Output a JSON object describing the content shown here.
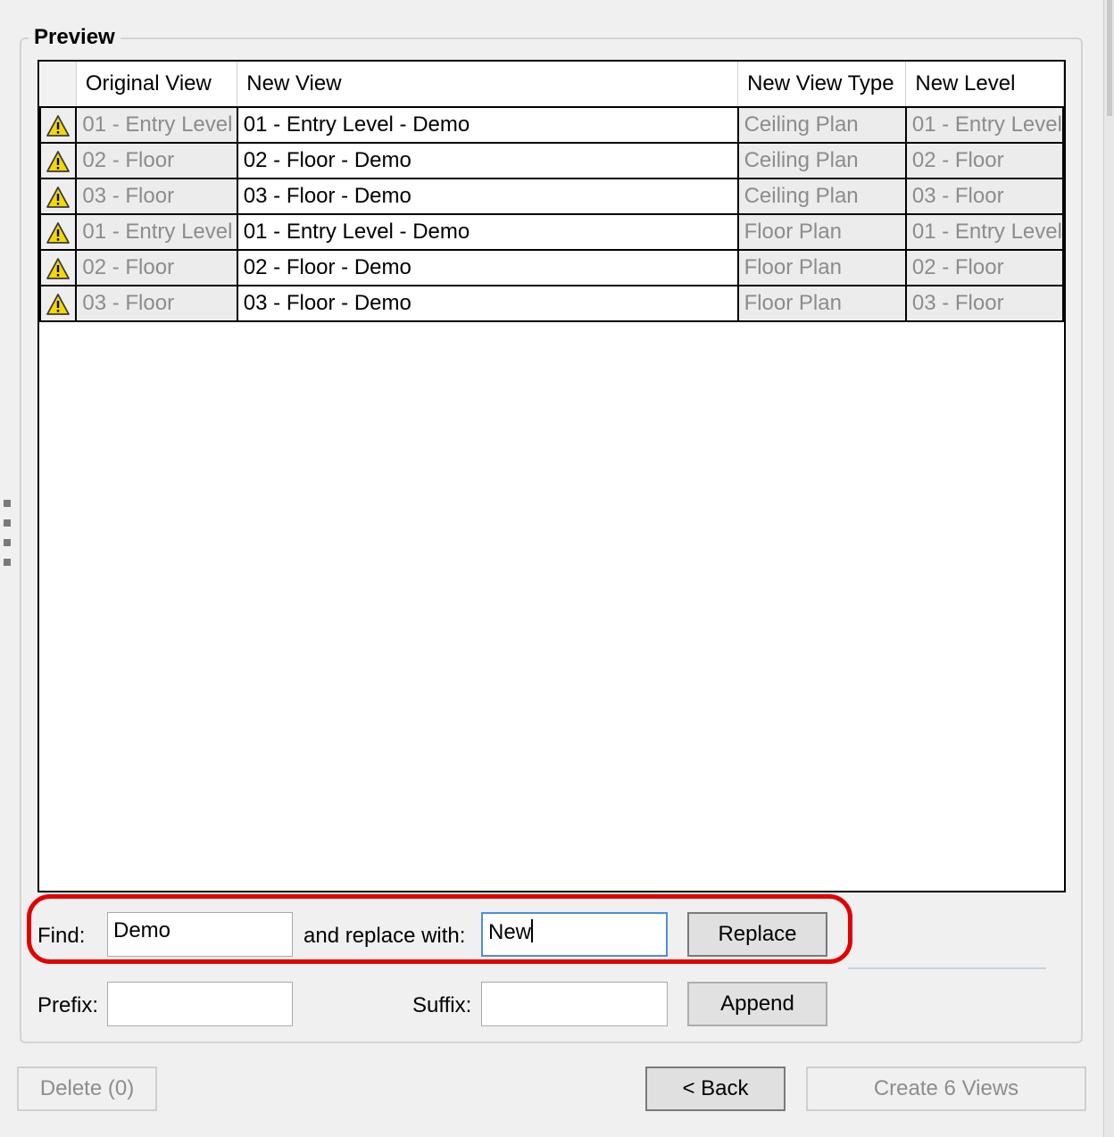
{
  "preview": {
    "title": "Preview",
    "columns": {
      "original_view": "Original View",
      "new_view": "New View",
      "new_view_type": "New View Type",
      "new_level": "New Level"
    },
    "rows": [
      {
        "status_icon": "warning-icon",
        "original_view": "01 - Entry Level",
        "new_view": "01 - Entry Level - Demo",
        "new_view_type": "Ceiling Plan",
        "new_level": "01 - Entry Level"
      },
      {
        "status_icon": "warning-icon",
        "original_view": "02 - Floor",
        "new_view": "02 - Floor - Demo",
        "new_view_type": "Ceiling Plan",
        "new_level": "02 - Floor"
      },
      {
        "status_icon": "warning-icon",
        "original_view": "03 - Floor",
        "new_view": "03 - Floor - Demo",
        "new_view_type": "Ceiling Plan",
        "new_level": "03 - Floor"
      },
      {
        "status_icon": "warning-icon",
        "original_view": "01 - Entry Level",
        "new_view": "01 - Entry Level - Demo",
        "new_view_type": "Floor Plan",
        "new_level": "01 - Entry Level"
      },
      {
        "status_icon": "warning-icon",
        "original_view": "02 - Floor",
        "new_view": "02 - Floor - Demo",
        "new_view_type": "Floor Plan",
        "new_level": "02 - Floor"
      },
      {
        "status_icon": "warning-icon",
        "original_view": "03 - Floor",
        "new_view": "03 - Floor - Demo",
        "new_view_type": "Floor Plan",
        "new_level": "03 - Floor"
      }
    ]
  },
  "find_replace": {
    "find_label": "Find:",
    "find_value": "Demo",
    "replace_label": "and replace with:",
    "replace_value": "New",
    "replace_button": "Replace"
  },
  "prefix_suffix": {
    "prefix_label": "Prefix:",
    "prefix_value": "",
    "suffix_label": "Suffix:",
    "suffix_value": "",
    "append_button": "Append"
  },
  "footer": {
    "delete_button": "Delete (0)",
    "back_button": "< Back",
    "create_button": "Create 6 Views"
  },
  "colors": {
    "highlight": "#e20000",
    "warning_fill": "#f5d800",
    "focus_border": "#4a90d9"
  }
}
